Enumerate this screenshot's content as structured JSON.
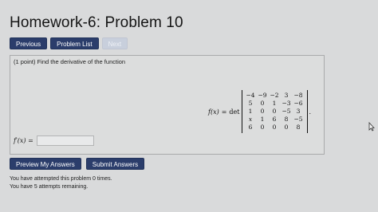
{
  "header": {
    "title": "Homework-6: Problem 10"
  },
  "nav": {
    "previous_label": "Previous",
    "problem_list_label": "Problem List",
    "next_label": "Next"
  },
  "problem": {
    "prompt": "(1 point) Find the derivative of the function",
    "lhs": "f(x)",
    "equals": "=",
    "det": "det",
    "matrix": [
      [
        "−4",
        "−9",
        "−2",
        "3",
        "−8"
      ],
      [
        "5",
        "0",
        "1",
        "−3",
        "−6"
      ],
      [
        "1",
        "0",
        "0",
        "−5",
        "3"
      ],
      [
        "x",
        "1",
        "6",
        "8",
        "−5"
      ],
      [
        "6",
        "0",
        "0",
        "0",
        "8"
      ]
    ],
    "period": ".",
    "answer_label": "f′(x) =",
    "answer_value": ""
  },
  "actions": {
    "preview_label": "Preview My Answers",
    "submit_label": "Submit Answers"
  },
  "status": {
    "attempted": "You have attempted this problem 0 times.",
    "remaining": "You have 5 attempts remaining."
  },
  "colors": {
    "button_bg": "#2b3d6b",
    "button_disabled_bg": "#c8cfdc",
    "page_bg": "#d9dadb"
  },
  "icons": {
    "cursor": "mouse-pointer-icon"
  }
}
